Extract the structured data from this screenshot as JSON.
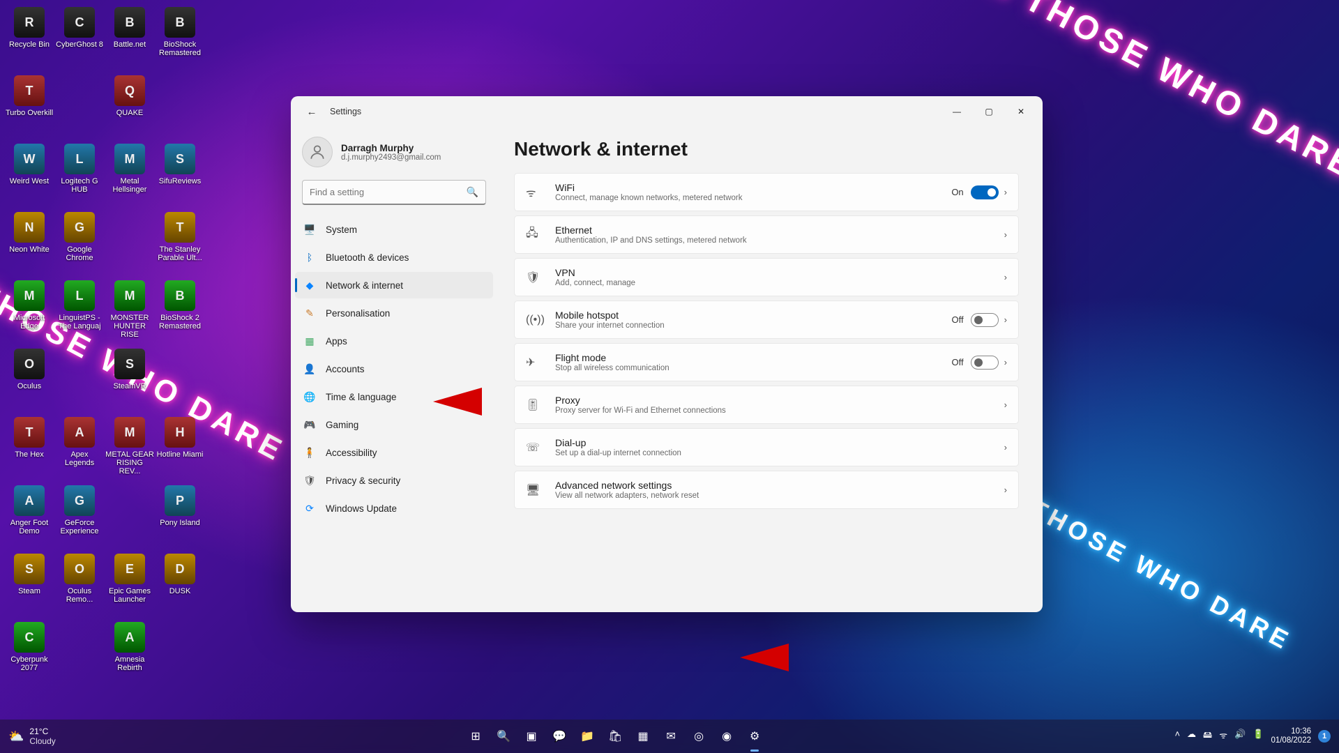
{
  "wallpaper_texts": [
    "FOR THOSE WHO DARE",
    "FOR THOSE WHO DARE",
    "FOR THOSE WHO DARE"
  ],
  "desktopIcons": [
    "Recycle Bin",
    "Turbo Overkill",
    "Weird West",
    "Neon White",
    "Microsoft Edge",
    "Oculus",
    "The Hex",
    "Anger Foot Demo",
    "Steam",
    "Cyberpunk 2077",
    "CyberGhost 8",
    "",
    "Logitech G HUB",
    "Google Chrome",
    "LinguistPS - The Languaj",
    "",
    "Apex Legends",
    "GeForce Experience",
    "Oculus Remo...",
    "",
    "Battle.net",
    "QUAKE",
    "Metal Hellsinger",
    "",
    "MONSTER HUNTER RISE",
    "SteamVR",
    "METAL GEAR RISING REV...",
    "",
    "Epic Games Launcher",
    "Amnesia Rebirth",
    "BioShock Remastered",
    "",
    "SifuReviews",
    "The Stanley Parable Ult...",
    "BioShock 2 Remastered",
    "",
    "Hotline Miami",
    "Pony Island",
    "DUSK",
    ""
  ],
  "window": {
    "title": "Settings",
    "account": {
      "name": "Darragh Murphy",
      "email": "d.j.murphy2493@gmail.com"
    },
    "search_placeholder": "Find a setting",
    "nav": [
      {
        "icon": "🖥️",
        "label": "System",
        "sel": false,
        "color": "#3a7bd5"
      },
      {
        "icon": "ᛒ",
        "label": "Bluetooth & devices",
        "sel": false,
        "color": "#0067c0"
      },
      {
        "icon": "◆",
        "label": "Network & internet",
        "sel": true,
        "color": "#0a84ff"
      },
      {
        "icon": "✎",
        "label": "Personalisation",
        "sel": false,
        "color": "#c97b2b"
      },
      {
        "icon": "▦",
        "label": "Apps",
        "sel": false,
        "color": "#4a6"
      },
      {
        "icon": "👤",
        "label": "Accounts",
        "sel": false,
        "color": "#556"
      },
      {
        "icon": "🌐",
        "label": "Time & language",
        "sel": false,
        "color": "#357"
      },
      {
        "icon": "🎮",
        "label": "Gaming",
        "sel": false,
        "color": "#555"
      },
      {
        "icon": "🧍",
        "label": "Accessibility",
        "sel": false,
        "color": "#2b6cb0"
      },
      {
        "icon": "🛡",
        "label": "Privacy & security",
        "sel": false,
        "color": "#555"
      },
      {
        "icon": "⟳",
        "label": "Windows Update",
        "sel": false,
        "color": "#0a84ff"
      }
    ],
    "page_title": "Network & internet",
    "items": [
      {
        "icon": "ᯤ",
        "title": "WiFi",
        "sub": "Connect, manage known networks, metered network",
        "toggle": "on",
        "status": "On"
      },
      {
        "icon": "🖧",
        "title": "Ethernet",
        "sub": "Authentication, IP and DNS settings, metered network"
      },
      {
        "icon": "🛡",
        "title": "VPN",
        "sub": "Add, connect, manage"
      },
      {
        "icon": "((•))",
        "title": "Mobile hotspot",
        "sub": "Share your internet connection",
        "toggle": "off",
        "status": "Off"
      },
      {
        "icon": "✈",
        "title": "Flight mode",
        "sub": "Stop all wireless communication",
        "toggle": "off",
        "status": "Off"
      },
      {
        "icon": "🎚",
        "title": "Proxy",
        "sub": "Proxy server for Wi-Fi and Ethernet connections"
      },
      {
        "icon": "☏",
        "title": "Dial-up",
        "sub": "Set up a dial-up internet connection"
      },
      {
        "icon": "🖥",
        "title": "Advanced network settings",
        "sub": "View all network adapters, network reset"
      }
    ]
  },
  "taskbar": {
    "weather": {
      "temp": "21°C",
      "cond": "Cloudy"
    },
    "center": [
      "start",
      "search",
      "taskview",
      "chat",
      "explorer",
      "store",
      "clipchamp",
      "mail",
      "chrome",
      "steam",
      "settings"
    ],
    "tray": [
      "˄",
      "☁",
      "🖴",
      "ᯤ",
      "🔊",
      "🔋"
    ],
    "time": "10:36",
    "date": "01/08/2022",
    "notif_count": "1"
  }
}
